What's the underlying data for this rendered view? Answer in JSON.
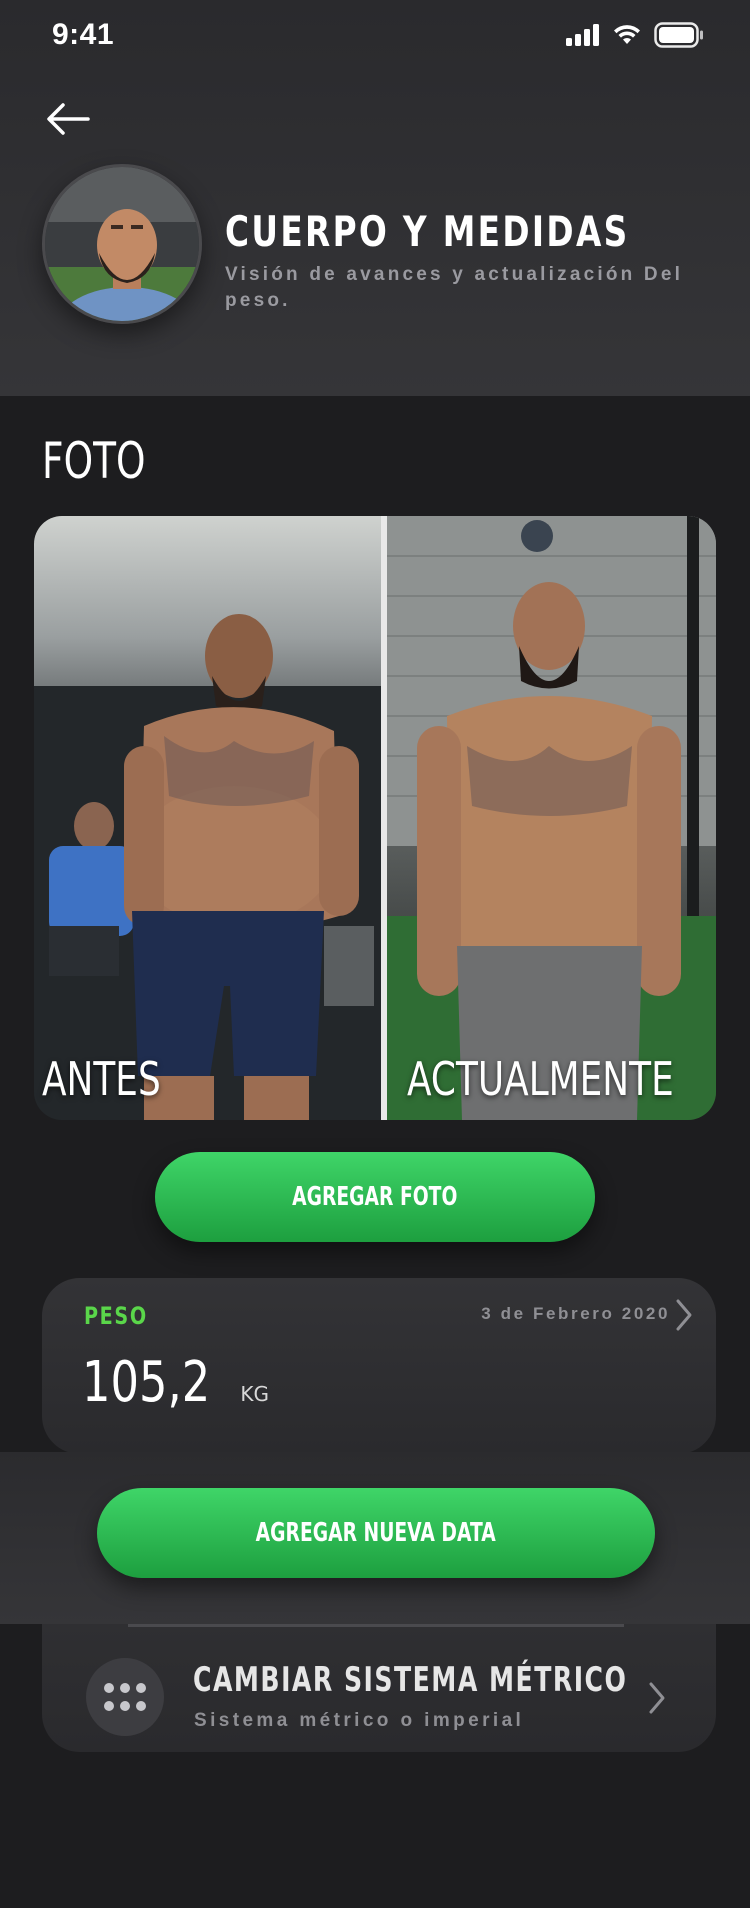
{
  "status_bar": {
    "time": "9:41"
  },
  "header": {
    "title": "CUERPO Y MEDIDAS",
    "subtitle": "Visión de avances y actualización Del peso."
  },
  "photo_section": {
    "title": "FOTO",
    "before_label": "ANTES",
    "after_label": "ACTUALMENTE",
    "add_photo_label": "AGREGAR FOTO"
  },
  "weight": {
    "label": "PESO",
    "date": "3 de Febrero 2020",
    "value": "105,2",
    "unit": "KG"
  },
  "add_data_label": "AGREGAR NUEVA DATA",
  "metric_system": {
    "title": "CAMBIAR SISTEMA MÉTRICO",
    "subtitle": "Sistema métrico o imperial"
  },
  "colors": {
    "background": "#1d1d1f",
    "accent_green": "#3fd568",
    "label_green": "#5ad64a",
    "card": "#2f2f32"
  },
  "icons": [
    "signal-icon",
    "wifi-icon",
    "battery-icon",
    "back-arrow-icon",
    "chevron-right-icon",
    "dots-grid-icon"
  ]
}
